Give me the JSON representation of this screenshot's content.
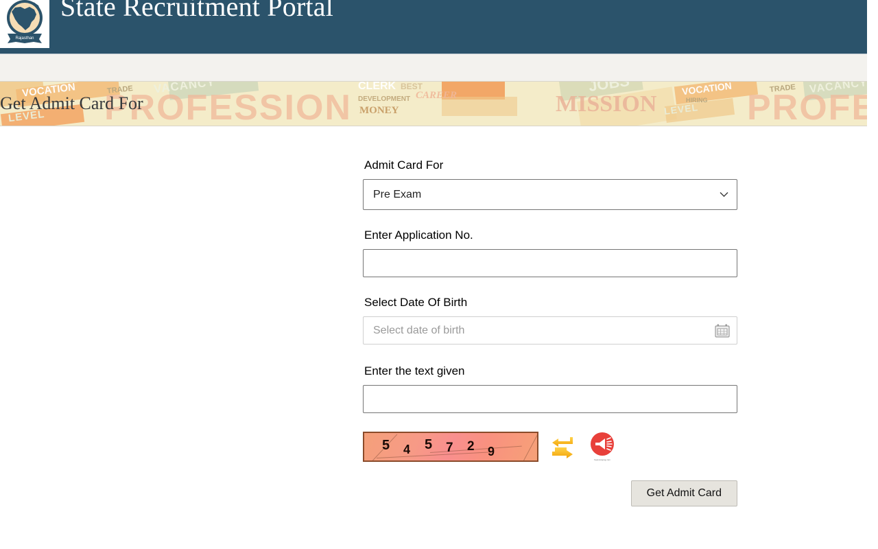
{
  "header": {
    "site_title": "State Recruitment Portal",
    "logo_name": "rajasthan-emblem-logo",
    "logo_ribbon_text": "Rajasthan",
    "bg_color": "#2b536b"
  },
  "navbar": {
    "bg_color": "#f3f2ee"
  },
  "banner": {
    "title": "Get Admit Card For",
    "bg_color": "#f4ecc9",
    "collage_words": [
      "VOCATION",
      "TRADE",
      "VACANCY",
      "PROFESSION",
      "LEVEL",
      "CLERK",
      "BEST",
      "DEVELOPMENT",
      "CAREER",
      "MONEY",
      "MISSION",
      "HIRING",
      "JOBS"
    ]
  },
  "form": {
    "admit_card_for": {
      "label": "Admit Card For",
      "selected": "Pre Exam",
      "options": [
        "Pre Exam"
      ]
    },
    "application_no": {
      "label": "Enter Application No.",
      "value": "",
      "placeholder": ""
    },
    "date_of_birth": {
      "label": "Select Date Of Birth",
      "value": "",
      "placeholder": "Select date of birth",
      "icon": "calendar-icon"
    },
    "captcha_text": {
      "label": "Enter the text given",
      "value": "",
      "placeholder": ""
    },
    "captcha": {
      "code": "545729",
      "digits": [
        "5",
        "4",
        "5",
        "7",
        "2",
        "9"
      ],
      "refresh_icon": "refresh-arrows-icon",
      "audio_icon": "audio-megaphone-icon",
      "audio_caption": "freeiconspng.com",
      "accent_color": "#e8403a"
    },
    "submit": {
      "label": "Get Admit Card"
    }
  }
}
